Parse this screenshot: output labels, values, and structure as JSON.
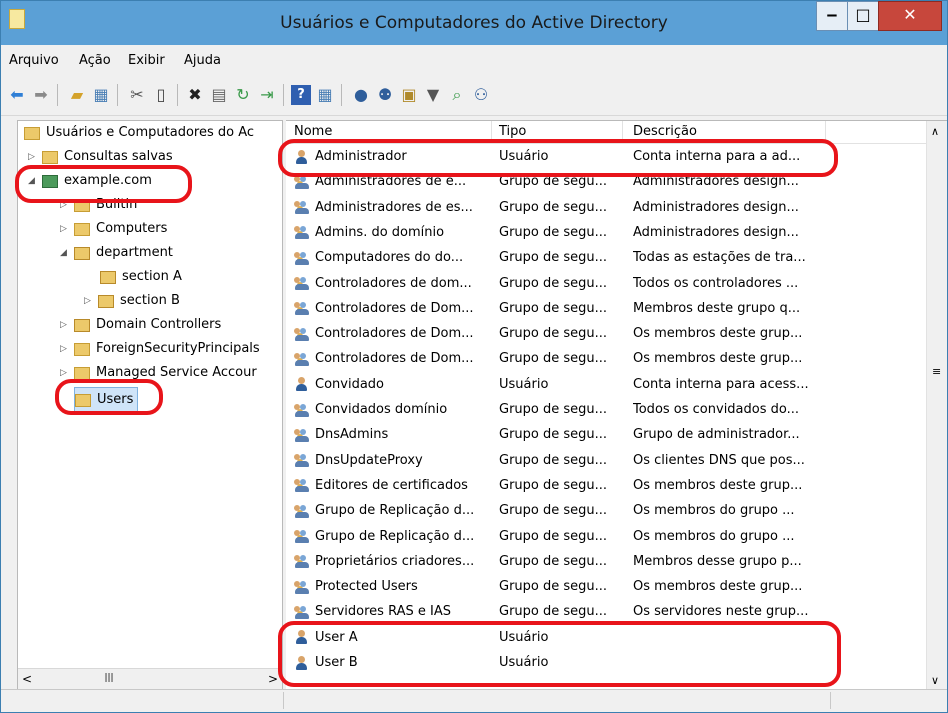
{
  "window": {
    "title": "Usuários e Computadores do Active Directory"
  },
  "menu": [
    "Arquivo",
    "Ação",
    "Exibir",
    "Ajuda"
  ],
  "toolbar_icons": [
    "back-icon",
    "forward-icon",
    "up-folder-icon",
    "console-tree-icon",
    "cut-icon",
    "copy-icon",
    "delete-icon",
    "properties-icon",
    "refresh-icon",
    "export-icon",
    "help-icon",
    "view-icon",
    "new-user-icon",
    "new-group-icon",
    "new-ou-icon",
    "filter-icon",
    "find-icon",
    "add-member-icon"
  ],
  "tree": {
    "root": "Usuários e Computadores do Ac",
    "items": [
      {
        "label": "Consultas salvas",
        "expander": "▷"
      },
      {
        "label": "example.com",
        "expander": "◢"
      },
      {
        "label": "Builtin",
        "expander": "▷"
      },
      {
        "label": "Computers",
        "expander": "▷"
      },
      {
        "label": "department",
        "expander": "◢"
      },
      {
        "label": "section A",
        "expander": ""
      },
      {
        "label": "section B",
        "expander": "▷"
      },
      {
        "label": "Domain Controllers",
        "expander": "▷"
      },
      {
        "label": "ForeignSecurityPrincipals",
        "expander": "▷"
      },
      {
        "label": "Managed Service Accour",
        "expander": "▷"
      },
      {
        "label": "Users",
        "expander": ""
      }
    ]
  },
  "list": {
    "columns": [
      "Nome",
      "Tipo",
      "Descrição"
    ],
    "rows": [
      {
        "name": "Administrador",
        "type": "Usuário",
        "desc": "Conta interna para a ad...",
        "kind": "user"
      },
      {
        "name": "Administradores de e...",
        "type": "Grupo de segu...",
        "desc": "Administradores design...",
        "kind": "group"
      },
      {
        "name": "Administradores de es...",
        "type": "Grupo de segu...",
        "desc": "Administradores design...",
        "kind": "group"
      },
      {
        "name": "Admins. do domínio",
        "type": "Grupo de segu...",
        "desc": "Administradores design...",
        "kind": "group"
      },
      {
        "name": "Computadores do do...",
        "type": "Grupo de segu...",
        "desc": "Todas as estações de tra...",
        "kind": "group"
      },
      {
        "name": "Controladores de dom...",
        "type": "Grupo de segu...",
        "desc": "Todos os controladores ...",
        "kind": "group"
      },
      {
        "name": "Controladores de Dom...",
        "type": "Grupo de segu...",
        "desc": "Membros deste grupo q...",
        "kind": "group"
      },
      {
        "name": "Controladores de Dom...",
        "type": "Grupo de segu...",
        "desc": "Os membros deste grup...",
        "kind": "group"
      },
      {
        "name": "Controladores de Dom...",
        "type": "Grupo de segu...",
        "desc": "Os membros deste grup...",
        "kind": "group"
      },
      {
        "name": "Convidado",
        "type": "Usuário",
        "desc": "Conta interna para acess...",
        "kind": "user"
      },
      {
        "name": "Convidados domínio",
        "type": "Grupo de segu...",
        "desc": "Todos os convidados do...",
        "kind": "group"
      },
      {
        "name": "DnsAdmins",
        "type": "Grupo de segu...",
        "desc": "Grupo de administrador...",
        "kind": "group"
      },
      {
        "name": "DnsUpdateProxy",
        "type": "Grupo de segu...",
        "desc": "Os clientes DNS que pos...",
        "kind": "group"
      },
      {
        "name": "Editores de certificados",
        "type": "Grupo de segu...",
        "desc": "Os membros deste grup...",
        "kind": "group"
      },
      {
        "name": "Grupo de Replicação d...",
        "type": "Grupo de segu...",
        "desc": "Os membros do grupo ...",
        "kind": "group"
      },
      {
        "name": "Grupo de Replicação d...",
        "type": "Grupo de segu...",
        "desc": "Os membros do grupo ...",
        "kind": "group"
      },
      {
        "name": "Proprietários criadores...",
        "type": "Grupo de segu...",
        "desc": "Membros desse grupo p...",
        "kind": "group"
      },
      {
        "name": "Protected Users",
        "type": "Grupo de segu...",
        "desc": "Os membros deste grup...",
        "kind": "group"
      },
      {
        "name": "Servidores RAS e IAS",
        "type": "Grupo de segu...",
        "desc": "Os servidores neste grup...",
        "kind": "group"
      },
      {
        "name": "User A",
        "type": "Usuário",
        "desc": "",
        "kind": "user"
      },
      {
        "name": "User B",
        "type": "Usuário",
        "desc": "",
        "kind": "user"
      }
    ]
  },
  "highlight_color": "#e8141a"
}
